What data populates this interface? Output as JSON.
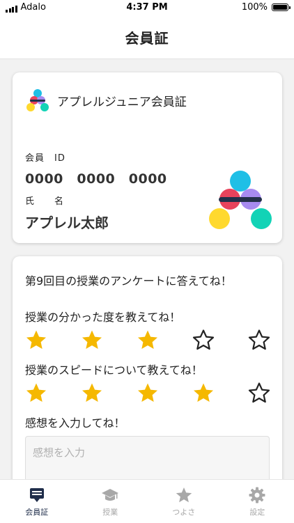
{
  "status_bar": {
    "carrier": "Adalo",
    "time": "4:37 PM",
    "battery": "100%"
  },
  "header": {
    "title": "会員証"
  },
  "member_card": {
    "title": "アプレルジュニア会員証",
    "id_label": "会員　ID",
    "id_value": "0000　0000　0000",
    "name_label": "氏　　名",
    "name_value": "アプレル太郎",
    "logo_colors": {
      "cyan": "#1fbfe6",
      "red": "#e8435c",
      "purple": "#a78bf0",
      "yellow": "#ffd92e",
      "teal": "#12d3b6",
      "bar": "#23304a"
    }
  },
  "survey": {
    "heading": "第9回目の授業のアンケートに答えてね！",
    "q1": "授業の分かった度を教えてね！",
    "q1_rating": 3,
    "q2": "授業のスピードについて教えてね！",
    "q2_rating": 4,
    "max_rating": 5,
    "q3": "感想を入力してね！",
    "comment_placeholder": "感想を入力",
    "star_color": "#f5b800"
  },
  "bottom_nav": {
    "items": [
      {
        "label": "会員証",
        "icon": "member-card-icon",
        "active": true
      },
      {
        "label": "授業",
        "icon": "graduation-cap-icon",
        "active": false
      },
      {
        "label": "つよさ",
        "icon": "star-icon",
        "active": false
      },
      {
        "label": "設定",
        "icon": "gear-icon",
        "active": false
      }
    ],
    "active_color": "#1f2d4a",
    "inactive_color": "#a8a8a8"
  }
}
